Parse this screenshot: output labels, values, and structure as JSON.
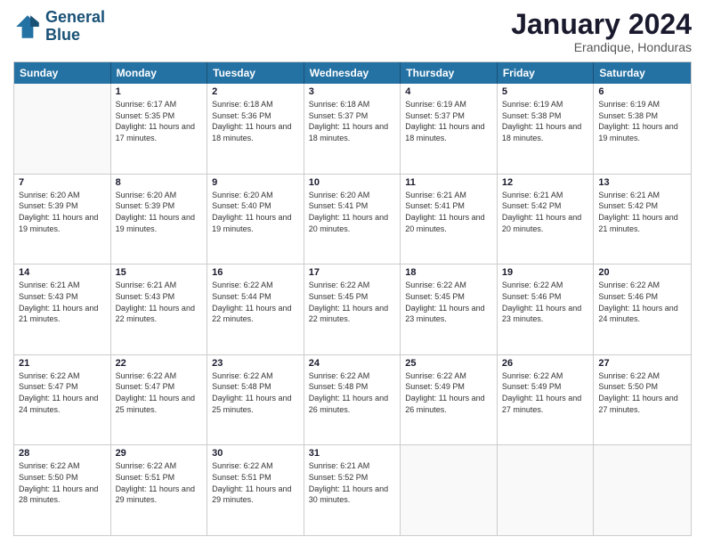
{
  "logo": {
    "line1": "General",
    "line2": "Blue"
  },
  "title": "January 2024",
  "subtitle": "Erandique, Honduras",
  "days": [
    "Sunday",
    "Monday",
    "Tuesday",
    "Wednesday",
    "Thursday",
    "Friday",
    "Saturday"
  ],
  "weeks": [
    [
      {
        "num": "",
        "empty": true
      },
      {
        "num": "1",
        "sunrise": "6:17 AM",
        "sunset": "5:35 PM",
        "daylight": "11 hours and 17 minutes."
      },
      {
        "num": "2",
        "sunrise": "6:18 AM",
        "sunset": "5:36 PM",
        "daylight": "11 hours and 18 minutes."
      },
      {
        "num": "3",
        "sunrise": "6:18 AM",
        "sunset": "5:37 PM",
        "daylight": "11 hours and 18 minutes."
      },
      {
        "num": "4",
        "sunrise": "6:19 AM",
        "sunset": "5:37 PM",
        "daylight": "11 hours and 18 minutes."
      },
      {
        "num": "5",
        "sunrise": "6:19 AM",
        "sunset": "5:38 PM",
        "daylight": "11 hours and 18 minutes."
      },
      {
        "num": "6",
        "sunrise": "6:19 AM",
        "sunset": "5:38 PM",
        "daylight": "11 hours and 19 minutes."
      }
    ],
    [
      {
        "num": "7",
        "sunrise": "6:20 AM",
        "sunset": "5:39 PM",
        "daylight": "11 hours and 19 minutes."
      },
      {
        "num": "8",
        "sunrise": "6:20 AM",
        "sunset": "5:39 PM",
        "daylight": "11 hours and 19 minutes."
      },
      {
        "num": "9",
        "sunrise": "6:20 AM",
        "sunset": "5:40 PM",
        "daylight": "11 hours and 19 minutes."
      },
      {
        "num": "10",
        "sunrise": "6:20 AM",
        "sunset": "5:41 PM",
        "daylight": "11 hours and 20 minutes."
      },
      {
        "num": "11",
        "sunrise": "6:21 AM",
        "sunset": "5:41 PM",
        "daylight": "11 hours and 20 minutes."
      },
      {
        "num": "12",
        "sunrise": "6:21 AM",
        "sunset": "5:42 PM",
        "daylight": "11 hours and 20 minutes."
      },
      {
        "num": "13",
        "sunrise": "6:21 AM",
        "sunset": "5:42 PM",
        "daylight": "11 hours and 21 minutes."
      }
    ],
    [
      {
        "num": "14",
        "sunrise": "6:21 AM",
        "sunset": "5:43 PM",
        "daylight": "11 hours and 21 minutes."
      },
      {
        "num": "15",
        "sunrise": "6:21 AM",
        "sunset": "5:43 PM",
        "daylight": "11 hours and 22 minutes."
      },
      {
        "num": "16",
        "sunrise": "6:22 AM",
        "sunset": "5:44 PM",
        "daylight": "11 hours and 22 minutes."
      },
      {
        "num": "17",
        "sunrise": "6:22 AM",
        "sunset": "5:45 PM",
        "daylight": "11 hours and 22 minutes."
      },
      {
        "num": "18",
        "sunrise": "6:22 AM",
        "sunset": "5:45 PM",
        "daylight": "11 hours and 23 minutes."
      },
      {
        "num": "19",
        "sunrise": "6:22 AM",
        "sunset": "5:46 PM",
        "daylight": "11 hours and 23 minutes."
      },
      {
        "num": "20",
        "sunrise": "6:22 AM",
        "sunset": "5:46 PM",
        "daylight": "11 hours and 24 minutes."
      }
    ],
    [
      {
        "num": "21",
        "sunrise": "6:22 AM",
        "sunset": "5:47 PM",
        "daylight": "11 hours and 24 minutes."
      },
      {
        "num": "22",
        "sunrise": "6:22 AM",
        "sunset": "5:47 PM",
        "daylight": "11 hours and 25 minutes."
      },
      {
        "num": "23",
        "sunrise": "6:22 AM",
        "sunset": "5:48 PM",
        "daylight": "11 hours and 25 minutes."
      },
      {
        "num": "24",
        "sunrise": "6:22 AM",
        "sunset": "5:48 PM",
        "daylight": "11 hours and 26 minutes."
      },
      {
        "num": "25",
        "sunrise": "6:22 AM",
        "sunset": "5:49 PM",
        "daylight": "11 hours and 26 minutes."
      },
      {
        "num": "26",
        "sunrise": "6:22 AM",
        "sunset": "5:49 PM",
        "daylight": "11 hours and 27 minutes."
      },
      {
        "num": "27",
        "sunrise": "6:22 AM",
        "sunset": "5:50 PM",
        "daylight": "11 hours and 27 minutes."
      }
    ],
    [
      {
        "num": "28",
        "sunrise": "6:22 AM",
        "sunset": "5:50 PM",
        "daylight": "11 hours and 28 minutes."
      },
      {
        "num": "29",
        "sunrise": "6:22 AM",
        "sunset": "5:51 PM",
        "daylight": "11 hours and 29 minutes."
      },
      {
        "num": "30",
        "sunrise": "6:22 AM",
        "sunset": "5:51 PM",
        "daylight": "11 hours and 29 minutes."
      },
      {
        "num": "31",
        "sunrise": "6:21 AM",
        "sunset": "5:52 PM",
        "daylight": "11 hours and 30 minutes."
      },
      {
        "num": "",
        "empty": true
      },
      {
        "num": "",
        "empty": true
      },
      {
        "num": "",
        "empty": true
      }
    ]
  ]
}
